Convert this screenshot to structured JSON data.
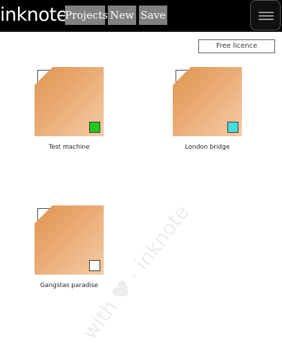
{
  "header": {
    "logo": "inknote",
    "nav": [
      {
        "label": "Projects"
      },
      {
        "label": "New"
      },
      {
        "label": "Save"
      }
    ],
    "menu_icon": "hamburger-menu-icon"
  },
  "licence_button": "Free licence",
  "projects": [
    {
      "name": "Test machine",
      "swatch_color": "#22c81e"
    },
    {
      "name": "London bridge",
      "swatch_color": "#45dede"
    },
    {
      "name": "Gangstas paradise",
      "swatch_color": "#ffffff"
    }
  ],
  "watermark": {
    "before": "with",
    "after": "- inknote",
    "icon": "heart-icon"
  },
  "colors": {
    "header_bg": "#000000",
    "nav_button_bg": "#808080",
    "thumb_gradient_start": "#df9653",
    "thumb_gradient_end": "#f5cba5"
  }
}
